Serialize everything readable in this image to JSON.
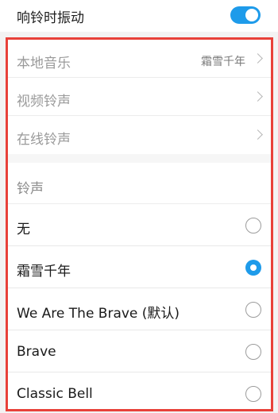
{
  "vibrate": {
    "label": "响铃时振动",
    "enabled": true,
    "accent": "#1e9bea"
  },
  "sources": [
    {
      "label": "本地音乐",
      "value": "霜雪千年",
      "icon": "chevron-right-icon"
    },
    {
      "label": "视频铃声",
      "value": "",
      "icon": "chevron-right-icon"
    },
    {
      "label": "在线铃声",
      "value": "",
      "icon": "chevron-right-icon"
    }
  ],
  "ringtones": {
    "title": "铃声",
    "selected_index": 1,
    "items": [
      {
        "label": "无"
      },
      {
        "label": "霜雪千年"
      },
      {
        "label": "We Are The Brave (默认)"
      },
      {
        "label": "Brave"
      },
      {
        "label": "Classic Bell"
      }
    ]
  },
  "highlight_color": "#e8413a"
}
